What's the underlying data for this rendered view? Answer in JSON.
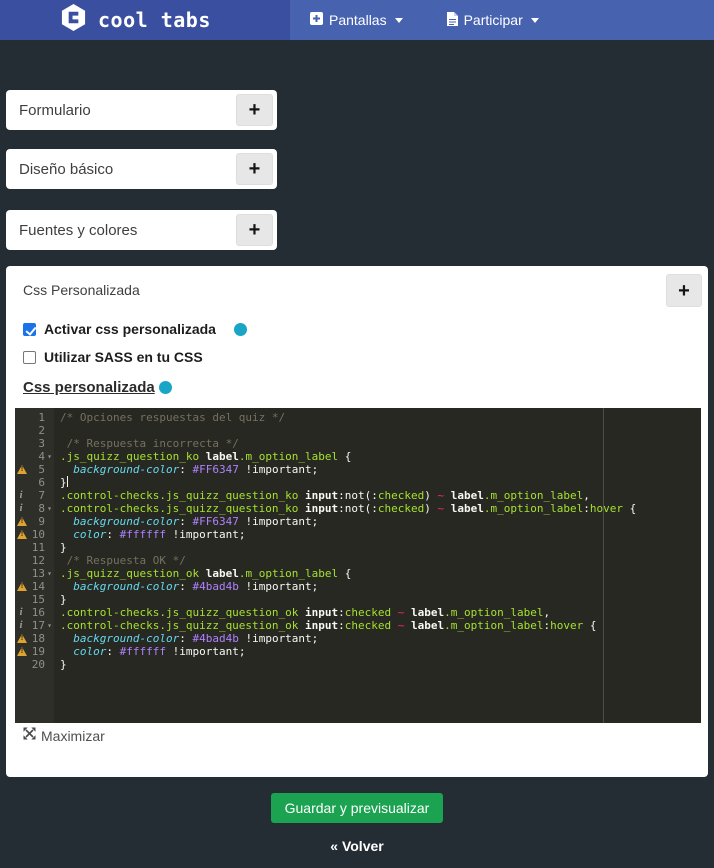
{
  "colors": {
    "page_bg": "#242d34",
    "header_left": "#3a4fa0",
    "header_right": "#4763b0",
    "check_blue": "#1a73e8",
    "info_teal": "#18a5c6",
    "green": "#1ba351",
    "ed_bg": "#272822",
    "ed_comment": "#75715e",
    "ed_green": "#a6e22e",
    "ed_pink": "#f92672",
    "ed_cyan": "#66d9ef",
    "ed_purple": "#ae81ff",
    "warn": "#dfa32f"
  },
  "header": {
    "brand": "cool tabs",
    "nav": [
      {
        "label": "Pantallas"
      },
      {
        "label": "Participar"
      }
    ]
  },
  "ui": {
    "plus": "+"
  },
  "accordions": [
    {
      "title": "Formulario"
    },
    {
      "title": "Diseño básico"
    },
    {
      "title": "Fuentes y colores"
    }
  ],
  "panel": {
    "title": "Css Personalizada",
    "checkbox_enable": {
      "label": "Activar css personalizada",
      "checked": true
    },
    "checkbox_sass": {
      "label": "Utilizar SASS en tu CSS",
      "checked": false
    },
    "editor_link": "Css personalizada",
    "maximize_label": "Maximizar"
  },
  "editor": {
    "gutter_icons": {
      "warn": "!",
      "info": "i"
    },
    "fold_glyph": "▾",
    "lines": [
      {
        "n": 1,
        "tok": [
          [
            "c",
            "/* Opciones respuestas del quiz */"
          ]
        ]
      },
      {
        "n": 2,
        "tok": []
      },
      {
        "n": 3,
        "tok": [
          [
            "p",
            " "
          ],
          [
            "c",
            "/* Respuesta incorrecta */"
          ]
        ]
      },
      {
        "n": 4,
        "fold": true,
        "tok": [
          [
            "q",
            ".js_quizz_question_ko"
          ],
          [
            "p",
            " "
          ],
          [
            "t",
            "label"
          ],
          [
            "q",
            ".m_option_label"
          ],
          [
            "p",
            " {"
          ]
        ]
      },
      {
        "n": 5,
        "icon": "warn",
        "tok": [
          [
            "p",
            "  "
          ],
          [
            "pr",
            "background-color"
          ],
          [
            "p",
            ": "
          ],
          [
            "v",
            "#FF6347"
          ],
          [
            "p",
            " !important;"
          ]
        ]
      },
      {
        "n": 6,
        "cursor": true,
        "tok": [
          [
            "p",
            "}"
          ]
        ]
      },
      {
        "n": 7,
        "icon": "info",
        "tok": [
          [
            "q",
            ".control-checks.js_quizz_question_ko"
          ],
          [
            "p",
            " "
          ],
          [
            "t",
            "input"
          ],
          [
            "p",
            ":not(:"
          ],
          [
            "ps",
            "checked"
          ],
          [
            "p",
            ") "
          ],
          [
            "op",
            "~"
          ],
          [
            "p",
            " "
          ],
          [
            "t",
            "label"
          ],
          [
            "q",
            ".m_option_label"
          ],
          [
            "p",
            ","
          ]
        ]
      },
      {
        "n": 8,
        "icon": "info",
        "fold": true,
        "tok": [
          [
            "q",
            ".control-checks.js_quizz_question_ko"
          ],
          [
            "p",
            " "
          ],
          [
            "t",
            "input"
          ],
          [
            "p",
            ":not(:"
          ],
          [
            "ps",
            "checked"
          ],
          [
            "p",
            ") "
          ],
          [
            "op",
            "~"
          ],
          [
            "p",
            " "
          ],
          [
            "t",
            "label"
          ],
          [
            "q",
            ".m_option_label"
          ],
          [
            "p",
            ":"
          ],
          [
            "ps",
            "hover"
          ],
          [
            "p",
            " {"
          ]
        ]
      },
      {
        "n": 9,
        "icon": "warn",
        "tok": [
          [
            "p",
            "  "
          ],
          [
            "pr",
            "background-color"
          ],
          [
            "p",
            ": "
          ],
          [
            "v",
            "#FF6347"
          ],
          [
            "p",
            " !important;"
          ]
        ]
      },
      {
        "n": 10,
        "icon": "warn",
        "tok": [
          [
            "p",
            "  "
          ],
          [
            "pr",
            "color"
          ],
          [
            "p",
            ": "
          ],
          [
            "v",
            "#ffffff"
          ],
          [
            "p",
            " !important;"
          ]
        ]
      },
      {
        "n": 11,
        "tok": [
          [
            "p",
            "}"
          ]
        ]
      },
      {
        "n": 12,
        "tok": [
          [
            "p",
            " "
          ],
          [
            "c",
            "/* Respuesta OK */"
          ]
        ]
      },
      {
        "n": 13,
        "fold": true,
        "tok": [
          [
            "q",
            ".js_quizz_question_ok"
          ],
          [
            "p",
            " "
          ],
          [
            "t",
            "label"
          ],
          [
            "q",
            ".m_option_label"
          ],
          [
            "p",
            " {"
          ]
        ]
      },
      {
        "n": 14,
        "icon": "warn",
        "tok": [
          [
            "p",
            "  "
          ],
          [
            "pr",
            "background-color"
          ],
          [
            "p",
            ": "
          ],
          [
            "v",
            "#4bad4b"
          ],
          [
            "p",
            " !important;"
          ]
        ]
      },
      {
        "n": 15,
        "tok": [
          [
            "p",
            "}"
          ]
        ]
      },
      {
        "n": 16,
        "icon": "info",
        "tok": [
          [
            "q",
            ".control-checks.js_quizz_question_ok"
          ],
          [
            "p",
            " "
          ],
          [
            "t",
            "input"
          ],
          [
            "p",
            ":"
          ],
          [
            "ps",
            "checked"
          ],
          [
            "p",
            " "
          ],
          [
            "op",
            "~"
          ],
          [
            "p",
            " "
          ],
          [
            "t",
            "label"
          ],
          [
            "q",
            ".m_option_label"
          ],
          [
            "p",
            ","
          ]
        ]
      },
      {
        "n": 17,
        "icon": "info",
        "fold": true,
        "tok": [
          [
            "q",
            ".control-checks.js_quizz_question_ok"
          ],
          [
            "p",
            " "
          ],
          [
            "t",
            "input"
          ],
          [
            "p",
            ":"
          ],
          [
            "ps",
            "checked"
          ],
          [
            "p",
            " "
          ],
          [
            "op",
            "~"
          ],
          [
            "p",
            " "
          ],
          [
            "t",
            "label"
          ],
          [
            "q",
            ".m_option_label"
          ],
          [
            "p",
            ":"
          ],
          [
            "ps",
            "hover"
          ],
          [
            "p",
            " {"
          ]
        ]
      },
      {
        "n": 18,
        "icon": "warn",
        "tok": [
          [
            "p",
            "  "
          ],
          [
            "pr",
            "background-color"
          ],
          [
            "p",
            ": "
          ],
          [
            "v",
            "#4bad4b"
          ],
          [
            "p",
            " !important;"
          ]
        ]
      },
      {
        "n": 19,
        "icon": "warn",
        "tok": [
          [
            "p",
            "  "
          ],
          [
            "pr",
            "color"
          ],
          [
            "p",
            ": "
          ],
          [
            "v",
            "#ffffff"
          ],
          [
            "p",
            " !important;"
          ]
        ]
      },
      {
        "n": 20,
        "tok": [
          [
            "p",
            "}"
          ]
        ]
      }
    ]
  },
  "footer": {
    "save_button": "Guardar y previsualizar",
    "back_link": "« Volver"
  }
}
